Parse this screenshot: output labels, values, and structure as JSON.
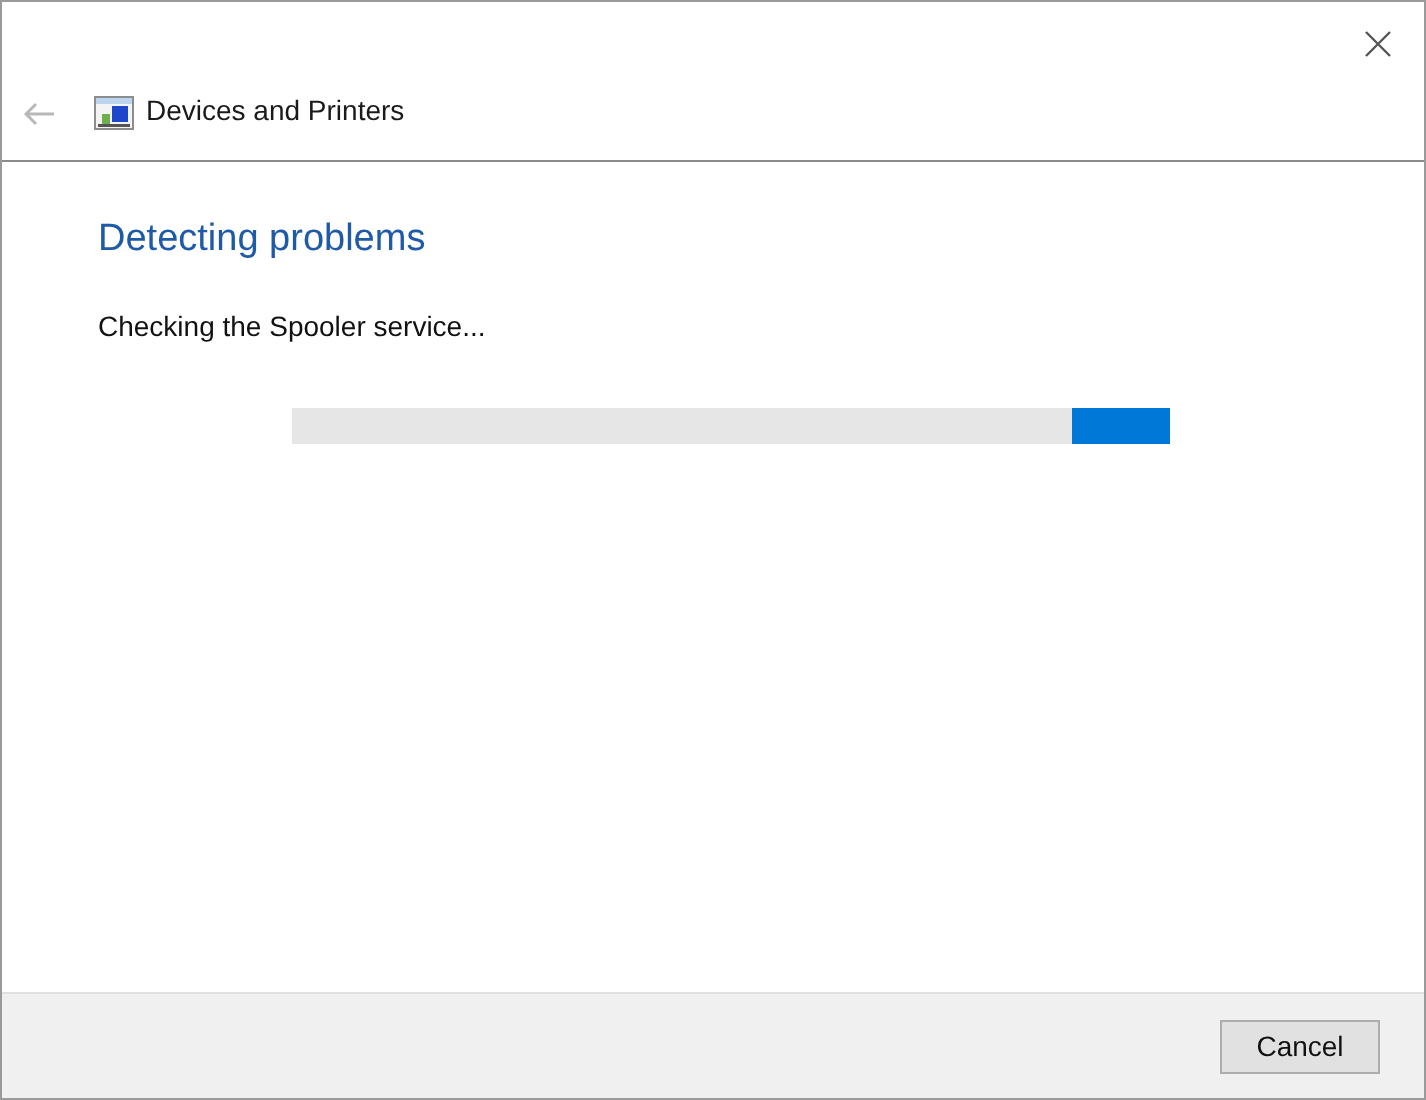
{
  "window": {
    "title": "Devices and Printers"
  },
  "back_button": {
    "disabled": true
  },
  "heading": "Detecting problems",
  "status": "Checking the Spooler service...",
  "progress": {
    "indeterminate": true
  },
  "buttons": [
    {
      "label": "Cancel"
    }
  ]
}
